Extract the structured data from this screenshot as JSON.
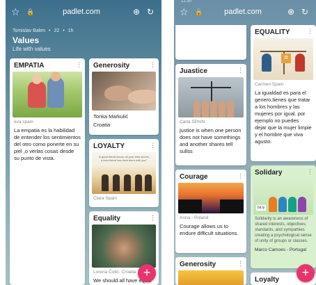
{
  "browser": {
    "url": "padlet.com",
    "status_time": "12:30"
  },
  "left": {
    "meta": {
      "author": "Tomislav Balen",
      "count": "22",
      "age": "1h"
    },
    "title": "Values",
    "subtitle": "Life with values",
    "cards": {
      "empatia": {
        "title": "EMPATIA",
        "author": "eva spain",
        "body": "La empatia es la habilidad de entender los sentimientos del otro como ponerte en su piel ,o verlas cosas desde su punto de vista."
      },
      "generosity": {
        "title": "Generosity",
        "author": "Tonka Markulić",
        "body": "Croatia"
      },
      "loyalty": {
        "title": "LOYALTY",
        "quote": "\"A good friend knows all your best stories, a best friend has lived them with you\"",
        "author": "Clara Spain"
      },
      "equality": {
        "title": "Equality",
        "author": "Lorena Čolić- Croatia",
        "body": "We should all have equal"
      }
    },
    "fab_label": "+"
  },
  "right": {
    "cards": {
      "equality": {
        "title": "EQUALITY",
        "author": "Carmen Spain",
        "body": "La igualdad es para el genero,tienes que tratar a los hombres y las mujeres por igual. por ejemplo no puedes dejar que la mujer limpie y el hombre que viva agusto.",
        "eq_sign": "="
      },
      "justice": {
        "title": "Juastice",
        "author": "Carla SPAIN",
        "body": "justice is when one person does not have somethings and another shares tell sullss"
      },
      "courage": {
        "title": "Courage",
        "author": "Anna - Poland",
        "body": "Courage allows us to endure difficult situations."
      },
      "solidary": {
        "title": "Solidary",
        "image_label": "bit.ly",
        "body": "Solidarity is an awareness of shared interests, objectives, standards, and sympathies creating a psychological sense of unity of groups or classes.",
        "author": "Marco Camoes - Portugal"
      },
      "generosity": {
        "title": "Generosity"
      },
      "loyalty": {
        "title": "Loyalty"
      }
    },
    "fab_label": "+"
  }
}
